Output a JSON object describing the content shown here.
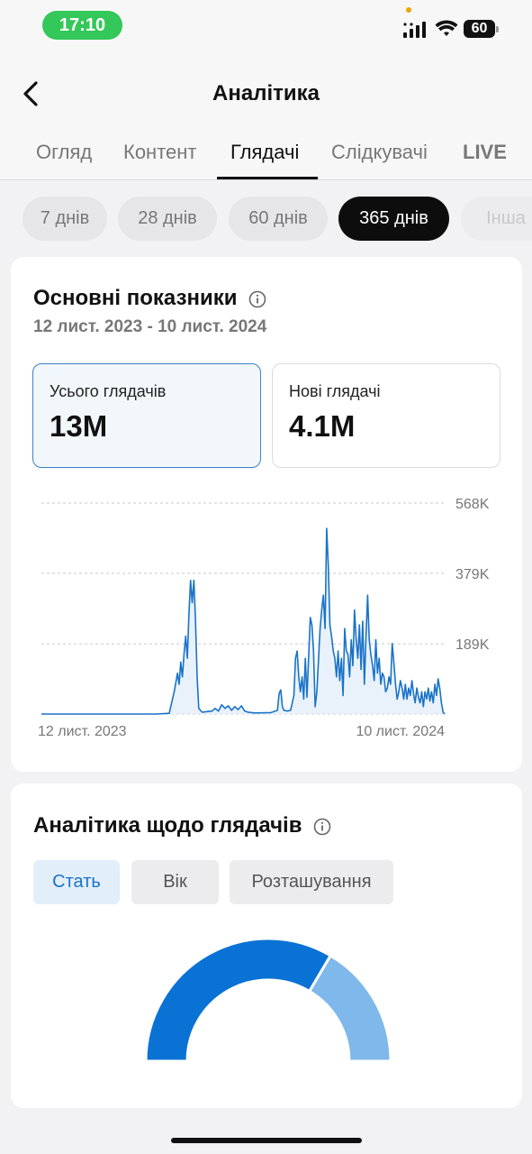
{
  "status": {
    "time": "17:10",
    "battery": "60"
  },
  "header": {
    "title": "Аналітика"
  },
  "tabs": [
    "Огляд",
    "Контент",
    "Глядачі",
    "Слідкувачі",
    "LIVE"
  ],
  "periods": [
    "7 днів",
    "28 днів",
    "60 днів",
    "365 днів",
    "Інша"
  ],
  "overview": {
    "title": "Основні показники",
    "date_range": "12 лист. 2023 - 10 лист. 2024",
    "metrics": [
      {
        "label": "Усього глядачів",
        "value": "13M"
      },
      {
        "label": "Нові глядачі",
        "value": "4.1M"
      }
    ]
  },
  "chart_data": {
    "type": "area",
    "color": "#1a73c8",
    "x_start_label": "12 лист. 2023",
    "x_end_label": "10 лист. 2024",
    "ylim": [
      0,
      568000
    ],
    "y_ticks": [
      "568K",
      "379K",
      "189K"
    ],
    "y_tick_values": [
      568000,
      379000,
      189000
    ],
    "values": [
      0,
      0,
      0,
      0,
      0,
      0,
      0,
      0,
      0,
      0,
      0,
      0,
      0,
      0,
      0,
      0,
      0,
      0,
      0,
      0,
      0,
      0,
      0,
      0,
      0,
      0,
      0,
      0,
      0,
      0,
      0,
      0,
      0,
      0,
      0,
      0,
      0,
      0,
      0,
      0,
      0,
      0,
      0,
      0,
      0,
      0,
      0,
      0,
      0,
      0,
      0,
      0,
      0,
      0,
      0,
      0,
      0,
      0,
      0,
      0,
      0,
      0,
      0,
      0,
      0,
      0,
      0,
      0,
      0,
      0,
      0,
      0,
      0,
      0,
      0,
      0,
      0,
      0,
      0,
      0,
      0,
      0,
      0,
      0,
      0,
      0,
      0,
      0,
      0,
      0,
      0,
      0,
      0,
      0,
      0,
      0,
      0,
      0,
      0,
      0,
      0,
      0,
      0,
      0,
      0,
      0,
      0,
      0,
      0,
      0,
      0,
      0,
      0,
      0,
      0,
      0,
      0,
      0,
      0,
      0,
      0,
      0,
      0,
      0,
      0,
      0,
      0,
      0,
      0,
      0,
      0,
      0,
      0,
      0,
      0,
      0,
      0,
      0,
      0,
      0,
      0,
      0,
      0,
      0,
      0,
      0,
      0,
      0,
      0,
      0,
      0,
      0,
      0,
      0,
      0,
      0,
      0,
      0,
      0,
      0,
      0,
      0,
      0,
      0,
      0,
      0,
      0,
      0,
      0,
      0,
      0,
      0,
      0,
      0,
      0,
      0,
      0,
      0,
      0,
      0,
      0,
      0,
      0,
      0,
      0,
      0,
      0,
      0,
      0,
      0,
      0,
      0,
      0,
      0,
      0,
      0,
      0,
      0,
      0,
      0,
      0,
      0,
      0,
      0,
      0,
      0,
      0,
      0,
      0,
      0,
      0,
      0,
      0,
      0,
      0,
      0,
      0,
      0,
      0,
      0,
      0,
      0,
      0,
      0,
      0,
      0,
      0,
      0,
      0,
      0,
      0,
      0,
      0,
      0,
      0,
      0,
      0,
      0,
      0,
      0,
      0,
      0,
      0,
      0,
      0,
      0,
      0,
      0,
      0,
      0,
      0,
      0,
      0,
      0,
      0,
      0,
      0,
      0,
      0,
      0,
      0,
      0,
      0,
      0,
      0,
      0,
      0,
      0,
      0,
      0,
      0,
      0,
      0,
      0,
      0,
      0,
      0,
      0,
      0,
      0,
      0,
      0,
      0,
      0,
      0,
      0,
      0,
      0,
      0,
      0,
      0,
      0,
      0,
      0,
      0,
      0,
      0,
      0,
      0,
      0,
      0,
      0,
      0,
      0,
      0,
      0,
      0,
      0,
      0,
      0,
      0,
      0,
      0,
      0,
      0,
      0,
      0,
      0,
      0,
      0,
      0,
      0,
      0,
      0,
      0,
      0,
      0,
      0,
      0,
      0,
      0,
      0,
      0,
      0,
      0,
      0,
      0,
      0,
      0,
      0,
      0,
      0,
      0,
      0,
      0,
      0,
      0,
      0,
      0,
      0,
      0,
      0,
      0,
      0,
      0,
      0,
      0,
      0,
      0,
      0,
      0,
      0,
      0,
      0,
      0,
      0,
      0,
      0,
      0,
      0,
      0,
      0,
      0,
      0,
      0,
      0,
      0,
      0,
      0,
      0,
      0,
      0,
      0,
      0,
      0,
      0,
      0,
      0,
      0,
      0,
      0,
      0,
      0,
      0,
      0
    ],
    "peaks": [
      [
        0,
        0
      ],
      [
        70,
        0
      ],
      [
        78,
        2000
      ],
      [
        81,
        60000
      ],
      [
        83,
        110000
      ],
      [
        84,
        80000
      ],
      [
        85,
        140000
      ],
      [
        86,
        100000
      ],
      [
        87,
        160000
      ],
      [
        88,
        210000
      ],
      [
        89,
        150000
      ],
      [
        90,
        270000
      ],
      [
        91,
        360000
      ],
      [
        92,
        300000
      ],
      [
        93,
        360000
      ],
      [
        94,
        250000
      ],
      [
        95,
        100000
      ],
      [
        96,
        15000
      ],
      [
        98,
        5000
      ],
      [
        104,
        8000
      ],
      [
        106,
        15000
      ],
      [
        108,
        8000
      ],
      [
        110,
        25000
      ],
      [
        112,
        15000
      ],
      [
        114,
        22000
      ],
      [
        116,
        10000
      ],
      [
        118,
        20000
      ],
      [
        120,
        12000
      ],
      [
        122,
        22000
      ],
      [
        124,
        8000
      ],
      [
        126,
        5000
      ],
      [
        130,
        3000
      ],
      [
        140,
        4000
      ],
      [
        144,
        10000
      ],
      [
        145,
        55000
      ],
      [
        146,
        65000
      ],
      [
        147,
        20000
      ],
      [
        148,
        10000
      ],
      [
        150,
        8000
      ],
      [
        152,
        10000
      ],
      [
        154,
        50000
      ],
      [
        155,
        150000
      ],
      [
        156,
        170000
      ],
      [
        157,
        100000
      ],
      [
        158,
        60000
      ],
      [
        159,
        100000
      ],
      [
        160,
        40000
      ],
      [
        161,
        150000
      ],
      [
        162,
        45000
      ],
      [
        164,
        260000
      ],
      [
        165,
        240000
      ],
      [
        166,
        170000
      ],
      [
        167,
        20000
      ],
      [
        168,
        60000
      ],
      [
        170,
        230000
      ],
      [
        171,
        280000
      ],
      [
        172,
        320000
      ],
      [
        173,
        230000
      ],
      [
        174,
        500000
      ],
      [
        175,
        400000
      ],
      [
        176,
        240000
      ],
      [
        177,
        210000
      ],
      [
        178,
        170000
      ],
      [
        179,
        150000
      ],
      [
        180,
        100000
      ],
      [
        181,
        170000
      ],
      [
        182,
        90000
      ],
      [
        183,
        150000
      ],
      [
        184,
        50000
      ],
      [
        185,
        230000
      ],
      [
        186,
        170000
      ],
      [
        187,
        160000
      ],
      [
        188,
        100000
      ],
      [
        189,
        200000
      ],
      [
        190,
        130000
      ],
      [
        191,
        280000
      ],
      [
        192,
        200000
      ],
      [
        193,
        150000
      ],
      [
        194,
        240000
      ],
      [
        195,
        120000
      ],
      [
        196,
        250000
      ],
      [
        197,
        80000
      ],
      [
        198,
        210000
      ],
      [
        199,
        320000
      ],
      [
        200,
        200000
      ],
      [
        201,
        160000
      ],
      [
        202,
        130000
      ],
      [
        203,
        90000
      ],
      [
        204,
        200000
      ],
      [
        205,
        110000
      ],
      [
        206,
        150000
      ],
      [
        207,
        80000
      ],
      [
        208,
        110000
      ],
      [
        209,
        100000
      ],
      [
        210,
        60000
      ],
      [
        211,
        70000
      ],
      [
        212,
        100000
      ],
      [
        213,
        80000
      ],
      [
        214,
        190000
      ],
      [
        215,
        140000
      ],
      [
        216,
        80000
      ],
      [
        217,
        40000
      ],
      [
        218,
        60000
      ],
      [
        219,
        90000
      ],
      [
        220,
        70000
      ],
      [
        221,
        40000
      ],
      [
        222,
        80000
      ],
      [
        223,
        40000
      ],
      [
        224,
        70000
      ],
      [
        225,
        50000
      ],
      [
        226,
        90000
      ],
      [
        227,
        55000
      ],
      [
        228,
        30000
      ],
      [
        229,
        70000
      ],
      [
        230,
        45000
      ],
      [
        231,
        30000
      ],
      [
        232,
        60000
      ],
      [
        233,
        20000
      ],
      [
        234,
        60000
      ],
      [
        235,
        40000
      ],
      [
        236,
        70000
      ],
      [
        237,
        35000
      ],
      [
        238,
        60000
      ],
      [
        239,
        30000
      ],
      [
        240,
        80000
      ],
      [
        241,
        50000
      ],
      [
        242,
        95000
      ],
      [
        243,
        70000
      ],
      [
        244,
        30000
      ],
      [
        245,
        5000
      ],
      [
        246,
        0
      ]
    ]
  },
  "audience": {
    "title": "Аналітика щодо глядачів",
    "filters": [
      "Стать",
      "Вік",
      "Розташування"
    ],
    "gender_share": {
      "primary": 0.67,
      "secondary": 0.33
    },
    "primary_color": "#0a72d4",
    "secondary_color": "#7fb8ea"
  }
}
